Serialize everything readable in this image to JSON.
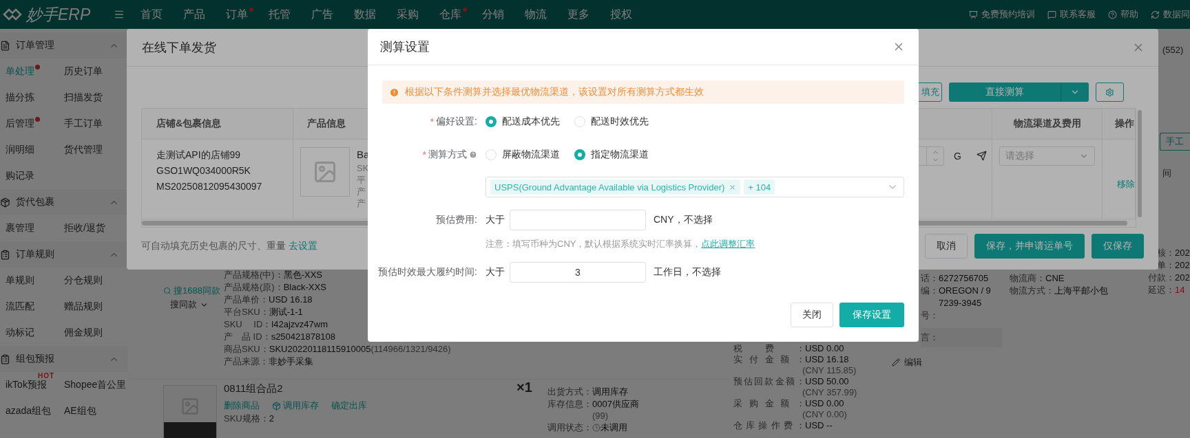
{
  "topbar": {
    "logo": "妙手ERP",
    "nav": [
      {
        "label": "首页",
        "dot": false
      },
      {
        "label": "产品",
        "dot": false
      },
      {
        "label": "订单",
        "dot": true
      },
      {
        "label": "托管",
        "dot": false
      },
      {
        "label": "广告",
        "dot": false
      },
      {
        "label": "数据",
        "dot": false
      },
      {
        "label": "采购",
        "dot": false
      },
      {
        "label": "仓库",
        "dot": true
      },
      {
        "label": "分销",
        "dot": false
      },
      {
        "label": "物流",
        "dot": false
      },
      {
        "label": "更多",
        "dot": false
      },
      {
        "label": "授权",
        "dot": false
      }
    ],
    "links": [
      "免费预约培训",
      "联系客服",
      "帮助",
      "数据同"
    ]
  },
  "sidebar": {
    "groups": [
      {
        "title": "订单管理",
        "expanded": true,
        "items": [
          {
            "label": "单处理",
            "selected": true,
            "dot": true
          },
          {
            "label": "历史订单",
            "selected": false,
            "dot": false
          },
          {
            "label": "描分拣",
            "selected": false,
            "dot": false
          },
          {
            "label": "扫描发货",
            "selected": false,
            "dot": false
          },
          {
            "label": "后管理",
            "selected": false,
            "dot": true
          },
          {
            "label": "手工订单",
            "selected": false,
            "dot": false
          },
          {
            "label": "润明细",
            "selected": false,
            "dot": false
          },
          {
            "label": "货代管理",
            "selected": false,
            "dot": false
          },
          {
            "label": "购记录",
            "selected": false,
            "dot": false
          }
        ]
      },
      {
        "title": "货代包裹",
        "expanded": true,
        "items": [
          {
            "label": "裹管理",
            "selected": false,
            "dot": false
          },
          {
            "label": "拒收/退货",
            "selected": false,
            "dot": false
          }
        ]
      },
      {
        "title": "订单规则",
        "expanded": true,
        "items": [
          {
            "label": "单规则",
            "selected": false,
            "dot": false
          },
          {
            "label": "分仓规则",
            "selected": false,
            "dot": false
          },
          {
            "label": "流匹配",
            "selected": false,
            "dot": false
          },
          {
            "label": "赠品规则",
            "selected": false,
            "dot": false
          },
          {
            "label": "动标记",
            "selected": false,
            "dot": false
          },
          {
            "label": "佣金规则",
            "selected": false,
            "dot": false
          }
        ]
      },
      {
        "title": "组包预报",
        "expanded": true,
        "items": [
          {
            "label": "ikTok预报",
            "selected": false,
            "dot": false,
            "badge": "HOT"
          },
          {
            "label": "Shopee首公里",
            "selected": false,
            "dot": false
          },
          {
            "label": "azada组包",
            "selected": false,
            "dot": false
          },
          {
            "label": "AE组包",
            "selected": false,
            "dot": false
          }
        ]
      }
    ]
  },
  "right_strip": {
    "count": "(552)",
    "button": "手工",
    "column_header": "间"
  },
  "order": {
    "product_1": {
      "search_link": "搜1688同款",
      "similar_button": "搜同款",
      "details": [
        {
          "label": "产品规格(中)：",
          "value": "黑色-XXS"
        },
        {
          "label": "产品规格(原)：",
          "value": "Black-XXS"
        },
        {
          "label": "产品单价：",
          "value": "USD 16.18"
        },
        {
          "label": "平台SKU：",
          "value": "测试-1-1"
        },
        {
          "label": "SKU　 ID：",
          "value": "l42ajzvz47wm"
        },
        {
          "label": "产　品 ID：",
          "value": "s250421878108"
        },
        {
          "label": "商品SKU：",
          "value": "SKU20220118115910005",
          "extra": "(114966/1321/9426)"
        },
        {
          "label": "产品来源：",
          "value": "非妙手采集"
        }
      ]
    },
    "product_2": {
      "title": "0811组合品2",
      "quantity": "×1",
      "actions": [
        {
          "label": "删除商品",
          "kind": "link"
        },
        {
          "label": "调用库存",
          "kind": "icon-link"
        },
        {
          "label": "确定出库",
          "kind": "link"
        }
      ],
      "details": [
        {
          "label": "SKU规格：",
          "value": "2"
        }
      ],
      "shipping": [
        {
          "kind": "line",
          "label": "出货方式：",
          "value": "调用库存"
        },
        {
          "kind": "line",
          "label": "库存信息：",
          "value": "0007供应商"
        },
        {
          "kind": "note",
          "value": "(99)"
        },
        {
          "kind": "status",
          "label": "调用状态：",
          "value": "未调用"
        }
      ]
    },
    "fees": [
      {
        "kind": "line",
        "label": "税费：",
        "value": "USD 0.00"
      },
      {
        "kind": "line",
        "label": "实付金额：",
        "value": "USD 16.18"
      },
      {
        "kind": "note",
        "value": "(CNY 115.85)"
      },
      {
        "kind": "line",
        "label": "预估回款金额：",
        "value": "USD 50.00"
      },
      {
        "kind": "note",
        "value": "(CNY 357.99)"
      },
      {
        "kind": "line",
        "label": "采购金额：",
        "value": "USD 0.00"
      },
      {
        "kind": "note",
        "value": "(CNY 0.00)"
      },
      {
        "kind": "line",
        "label": "仓库操作费：",
        "value": "USD --"
      }
    ],
    "address": [
      {
        "kind": "line",
        "label": "话：",
        "value": "6272756705"
      },
      {
        "kind": "line",
        "label": "编：",
        "value": "OREGON / 97239-3945"
      },
      {
        "kind": "line",
        "label": "号："
      },
      {
        "kind": "remark",
        "label": "言："
      }
    ],
    "edit": "编辑",
    "logistics": [
      {
        "label": "物流商：",
        "value": "CNE"
      },
      {
        "label": "物流方式：",
        "value": "上海平邮小包"
      }
    ],
    "dates": [
      {
        "label": "核：",
        "value": "202",
        "alert": false
      },
      {
        "label": "单：",
        "value": "202",
        "alert": false
      },
      {
        "label": "付款：",
        "value": "202",
        "alert": false
      },
      {
        "label": "延迟：",
        "value": "14",
        "alert": true
      }
    ]
  },
  "ship_dialog": {
    "title": "在线下单发货",
    "fill_button": "填充",
    "calc_button": "直接测算",
    "table": {
      "columns": [
        "店铺&包裹信息",
        "产品信息",
        "物流渠道及费用",
        "操作"
      ],
      "shop": [
        "走测试API的店铺99",
        "GSO1WQ034000R5K",
        "MS20250812095430097"
      ],
      "product_name": "Ba",
      "product_lines": [
        "SK",
        "平",
        "产",
        "产"
      ],
      "weight_unit": "G",
      "channel_placeholder": "请选择",
      "action": "移除"
    },
    "hint": "可自动填充历史包裹的尺寸、重量",
    "hint_link": "去设置",
    "buttons": [
      {
        "label": "取消",
        "kind": "default"
      },
      {
        "label": "保存，并申请运单号",
        "kind": "primary"
      },
      {
        "label": "仅保存",
        "kind": "primary"
      }
    ]
  },
  "calc_dialog": {
    "title": "测算设置",
    "alert": "根据以下条件测算并选择最优物流渠道，该设置对所有测算方式都生效",
    "preference": {
      "mark": "*",
      "label": "偏好设置:",
      "options": [
        {
          "label": "配送成本优先",
          "selected": true
        },
        {
          "label": "配送时效优先",
          "selected": false
        }
      ]
    },
    "method": {
      "mark": "*",
      "label": "测算方式",
      "options": [
        {
          "label": "屏蔽物流渠道",
          "selected": false
        },
        {
          "label": "指定物流渠道",
          "selected": true
        }
      ]
    },
    "channels": {
      "tags": [
        "USPS(Ground Advantage Available via Logistics Provider)"
      ],
      "more": "+ 104"
    },
    "cost": {
      "label": "预估费用:",
      "prefix": "大于",
      "suffix": "CNY，不选择"
    },
    "note": "注意：填写币种为CNY，默认根据系统实时汇率换算，",
    "note_link": "点此调整汇率",
    "time": {
      "label": "预估时效最大履约时间:",
      "prefix": "大于",
      "value": "3",
      "suffix": "工作日，不选择"
    },
    "buttons": [
      {
        "label": "关闭",
        "kind": "default"
      },
      {
        "label": "保存设置",
        "kind": "primary"
      }
    ]
  }
}
